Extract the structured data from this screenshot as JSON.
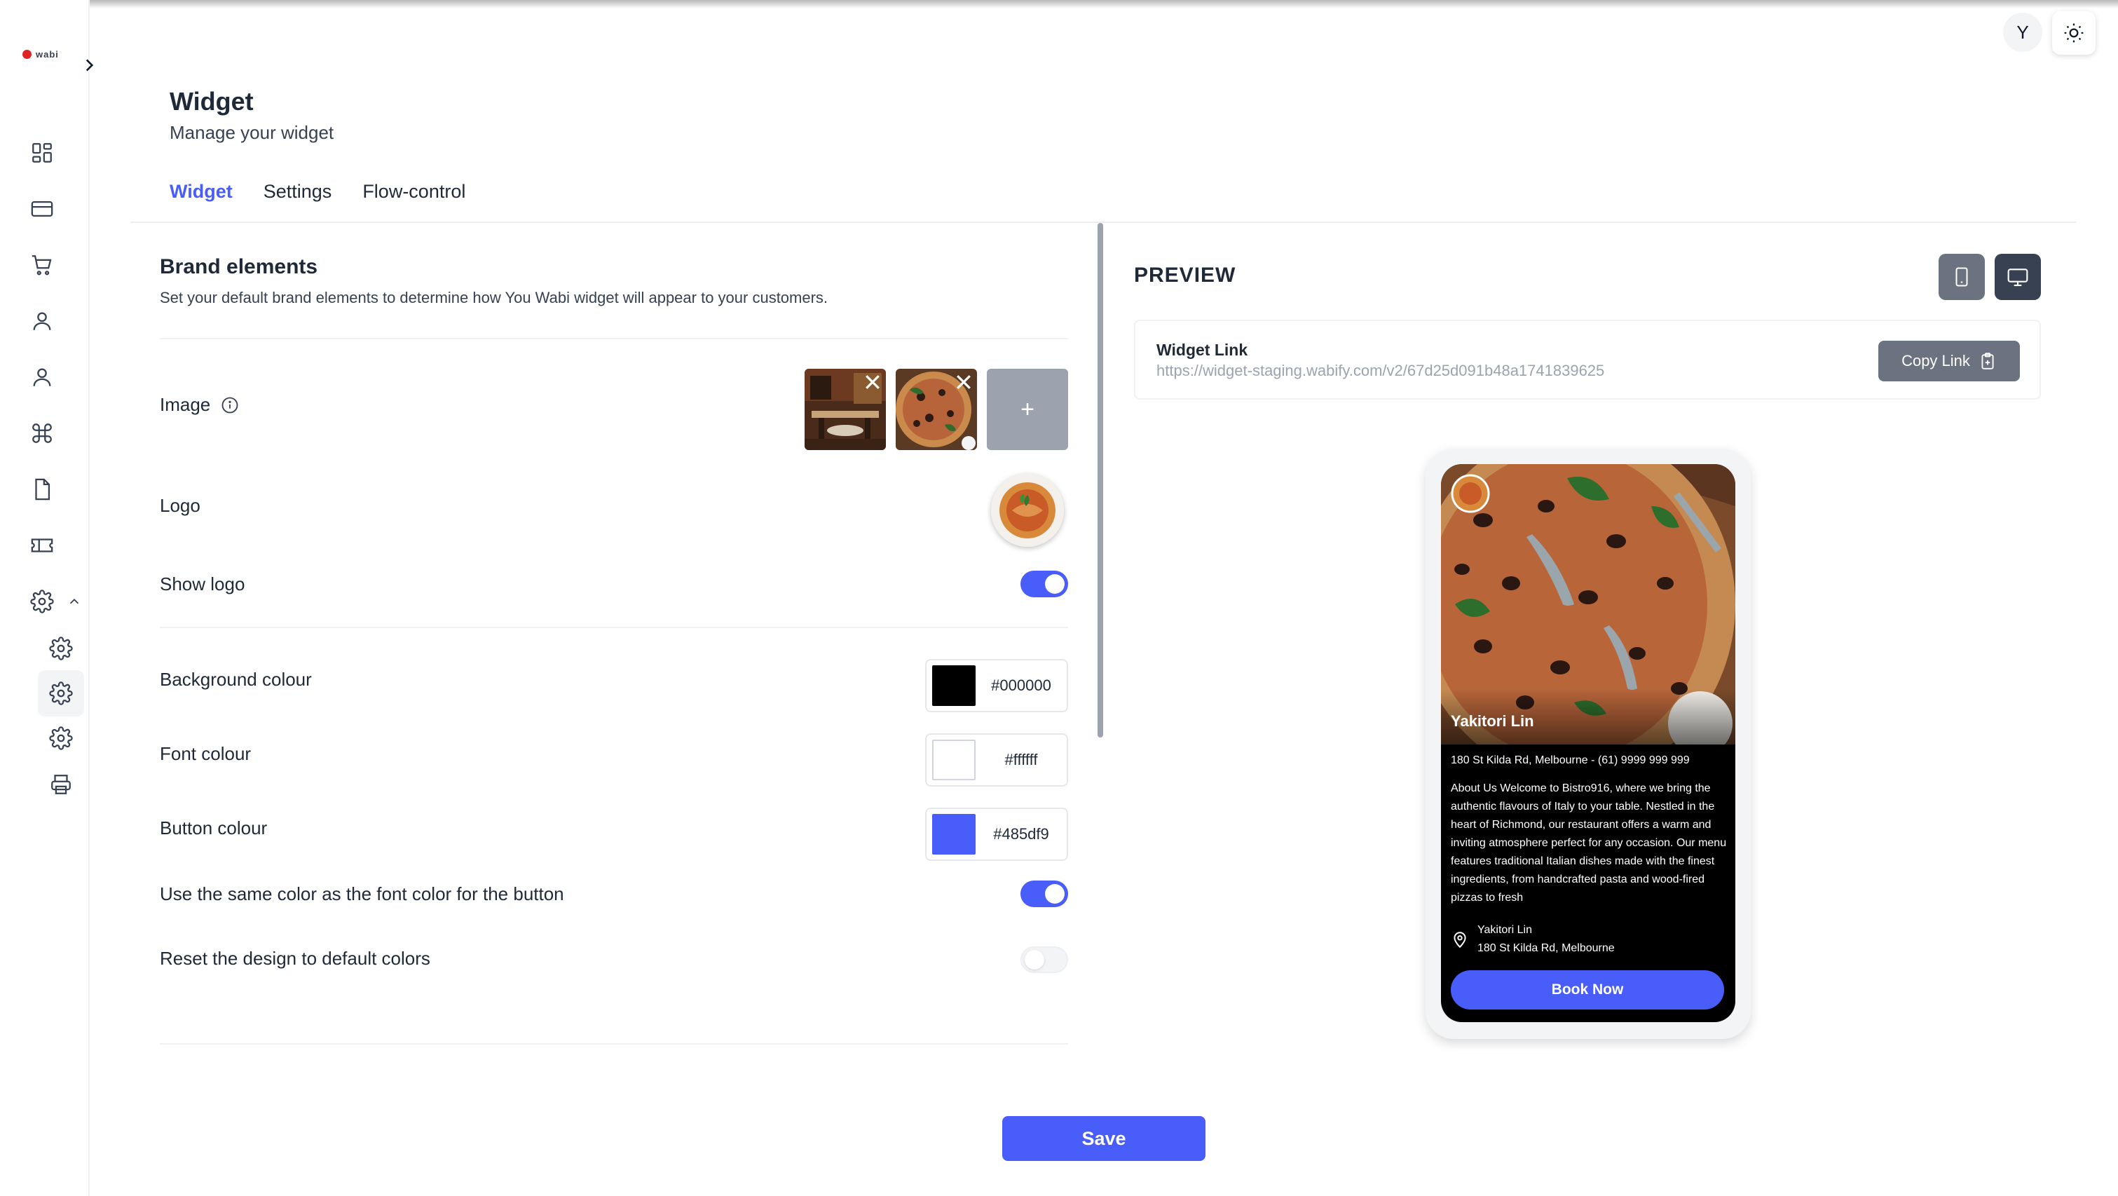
{
  "app": {
    "logo_text": "wabi"
  },
  "user": {
    "avatar_initial": "Y"
  },
  "header": {
    "title": "Widget",
    "subtitle": "Manage your widget"
  },
  "tabs": [
    {
      "label": "Widget",
      "active": true
    },
    {
      "label": "Settings",
      "active": false
    },
    {
      "label": "Flow-control",
      "active": false
    }
  ],
  "sidebar": {
    "icons": [
      "dashboard-icon",
      "card-icon",
      "cart-icon",
      "user-icon",
      "user-icon",
      "command-icon",
      "file-icon",
      "ticket-icon",
      "settings-icon"
    ],
    "sub_icons": [
      "settings-icon",
      "settings-icon",
      "settings-icon",
      "printer-icon"
    ]
  },
  "brand": {
    "title": "Brand elements",
    "description": "Set your default brand elements to determine how You Wabi widget will appear to your customers.",
    "image_label": "Image",
    "add_image": "+",
    "logo_label": "Logo",
    "show_logo_label": "Show logo",
    "show_logo": true
  },
  "colours": {
    "background": {
      "label": "Background colour",
      "value": "#000000"
    },
    "font": {
      "label": "Font colour",
      "value": "#ffffff"
    },
    "button": {
      "label": "Button colour",
      "value": "#485df9"
    }
  },
  "options": {
    "same_color_label": "Use the same color as the font color for the button",
    "same_color": true,
    "reset_label": "Reset the design to default colors",
    "reset": false
  },
  "actions": {
    "save": "Save"
  },
  "preview": {
    "title": "PREVIEW",
    "link_label": "Widget Link",
    "link_url": "https://widget-staging.wabify.com/v2/67d25d091b48a1741839625",
    "copy_label": "Copy Link",
    "restaurant_name": "Yakitori Lin",
    "address_line": "180 St Kilda Rd, Melbourne - (61) 9999 999 999",
    "about": "About Us Welcome to Bistro916, where we bring the authentic flavours of Italy to your table. Nestled in the heart of Richmond, our restaurant offers a warm and inviting atmosphere perfect for any occasion. Our menu features traditional Italian dishes made with the finest ingredients, from handcrafted pasta and wood-fired pizzas to fresh",
    "location_name": "Yakitori Lin",
    "location_address": "180 St Kilda Rd, Melbourne",
    "book_label": "Book Now"
  }
}
